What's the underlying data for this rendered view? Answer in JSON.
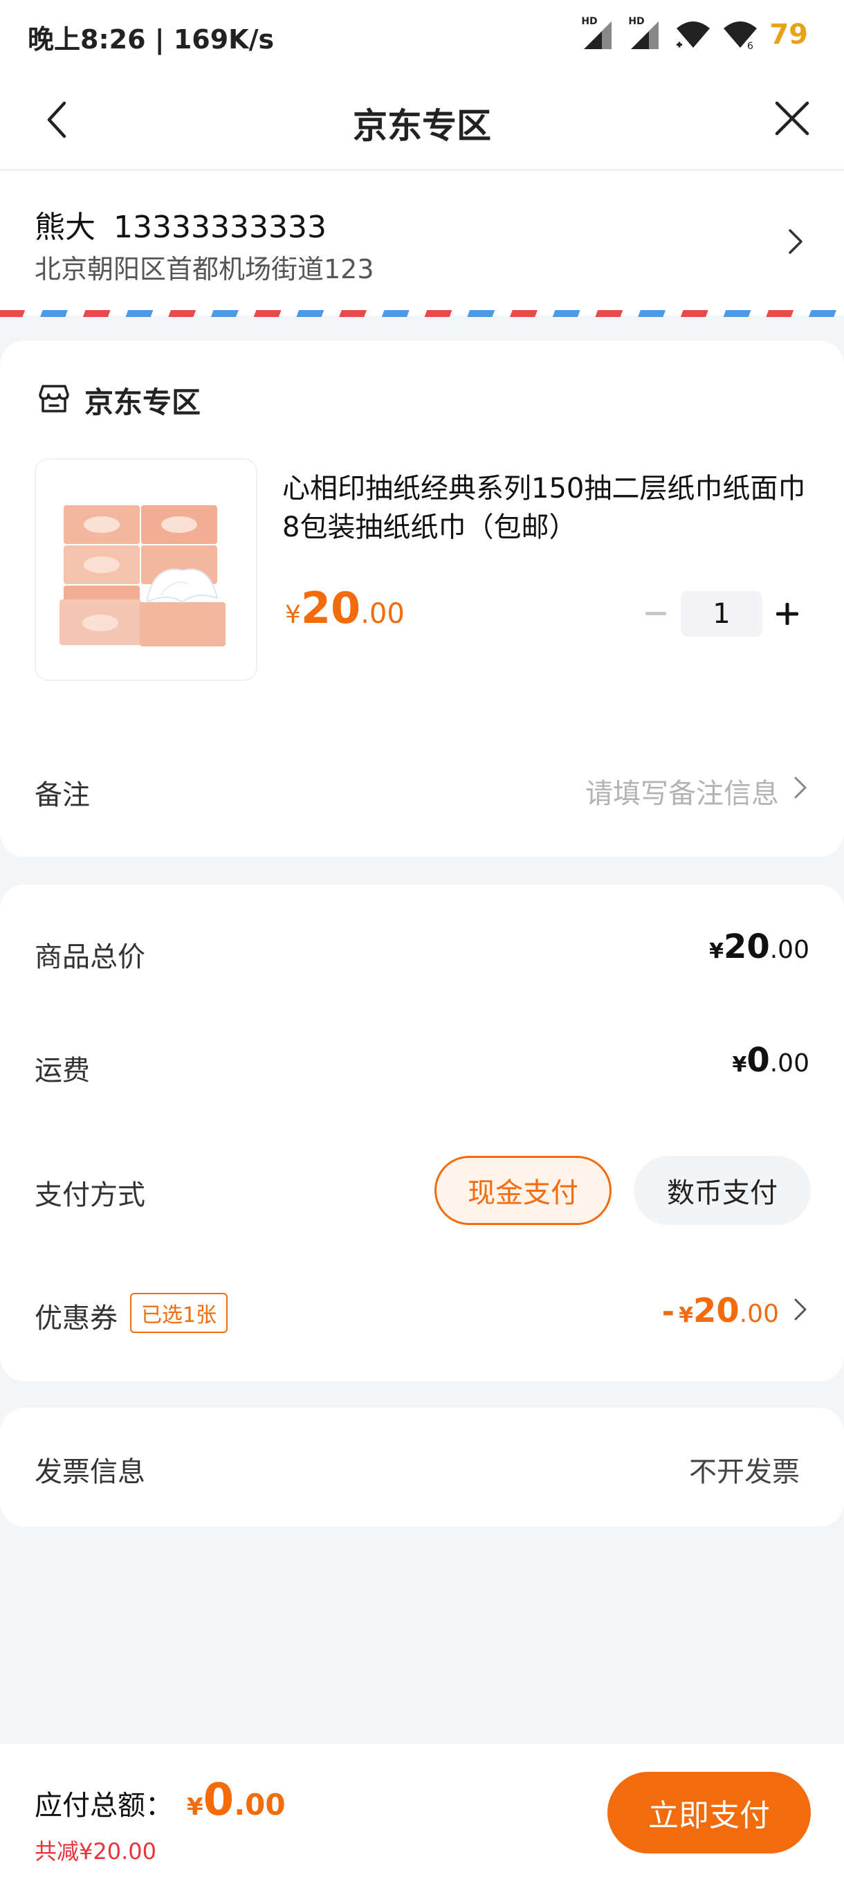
{
  "status_bar": {
    "time_speed": "晚上8:26 | 169K/s",
    "hd_label": "HD",
    "wifi_label": "6",
    "battery": "79"
  },
  "nav": {
    "title": "京东专区"
  },
  "address": {
    "name": "熊大",
    "phone": "13333333333",
    "detail": "北京朝阳区首都机场街道123"
  },
  "shop": {
    "name": "京东专区",
    "product": {
      "title": "心相印抽纸经典系列150抽二层纸巾纸面巾 8包装抽纸纸巾（包邮）",
      "currency": "¥",
      "price_int": "20",
      "price_dec": ".00",
      "quantity": "1",
      "image_icon": "tissue-box-icon"
    },
    "remark": {
      "label": "备注",
      "placeholder": "请填写备注信息"
    }
  },
  "price_summary": {
    "goods_total": {
      "label": "商品总价",
      "currency": "¥",
      "int": "20",
      "dec": ".00"
    },
    "shipping": {
      "label": "运费",
      "currency": "¥",
      "int": "0",
      "dec": ".00"
    },
    "payment": {
      "label": "支付方式",
      "options": [
        "现金支付",
        "数币支付"
      ],
      "selected": "现金支付"
    },
    "coupon": {
      "label": "优惠券",
      "badge": "已选1张",
      "minus": "-",
      "currency": "¥",
      "int": "20",
      "dec": ".00"
    }
  },
  "invoice": {
    "label": "发票信息",
    "value": "不开发票"
  },
  "bottom": {
    "total_label": "应付总额：",
    "currency": "¥",
    "total_int": "0",
    "total_dec": ".00",
    "discount": "共减¥20.00",
    "pay_button": "立即支付"
  },
  "colors": {
    "accent": "#f26b0d",
    "discount_red": "#e8343a",
    "background": "#f4f5f7",
    "battery": "#e8a21a"
  }
}
